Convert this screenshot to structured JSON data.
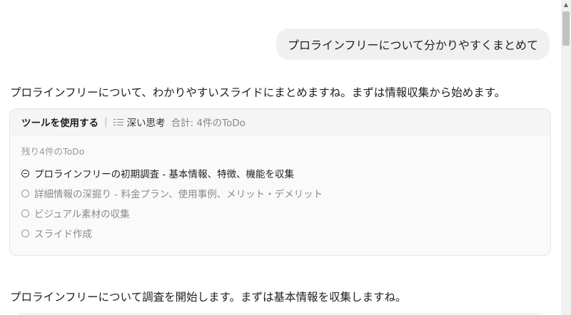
{
  "conversation": {
    "user_message": "プロラインフリーについて分かりやすくまとめて",
    "assistant_intro": "プロラインフリーについて、わかりやすいスライドにまとめますね。まずは情報収集から始めます。",
    "assistant_followup": "プロラインフリーについて調査を開始します。まずは基本情報を収集しますね。"
  },
  "tool_card": {
    "title": "ツールを使用する",
    "separator": "|",
    "mode_icon": "list-icon",
    "mode": "深い思考",
    "total": "合計: 4件のToDo",
    "remaining": "残り4件のToDo",
    "todos": [
      {
        "label": "プロラインフリーの初期調査 - 基本情報、特徴、機能を収集",
        "status": "in-progress"
      },
      {
        "label": "詳細情報の深掘り - 料金プラン、使用事例、メリット・デメリット",
        "status": "pending"
      },
      {
        "label": "ビジュアル素材の収集",
        "status": "pending"
      },
      {
        "label": "スライド作成",
        "status": "pending"
      }
    ]
  },
  "scrollbar": {
    "up_arrow": "▲"
  }
}
